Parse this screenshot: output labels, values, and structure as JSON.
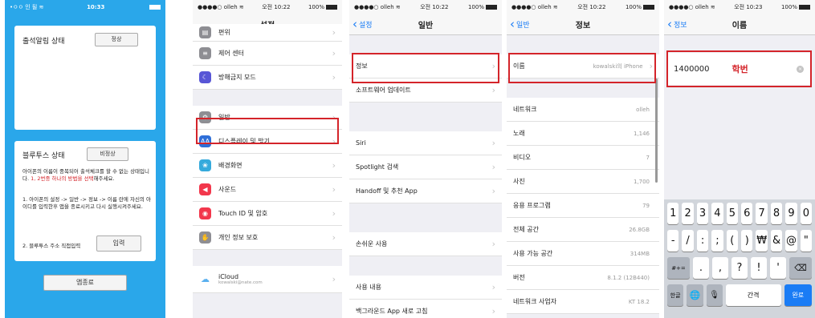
{
  "phone1": {
    "status": {
      "carrier": "•ㅇㅇ 인 될 ≋",
      "time": "10:33"
    },
    "attendance_label": "출석알림 상태",
    "attendance_value": "정상",
    "bt_label": "블루투스 상태",
    "bt_value": "비정상",
    "notice_a": "아이폰의 이름이 중복되어 출석체크를 할 수 없는 상태입니다.",
    "notice_red": "1, 2번중 하나의 방법을 선택",
    "notice_b": "해주세요.",
    "step1": "1. 아이폰의 설정 -> 일반 -> 정보 -> 이름 란에 자신의 아이디를 입력한후 앱을 종료시키고 다시 실행시켜주세요.",
    "step2": "2. 블루투스 주소 직접입력",
    "input_btn": "입력",
    "exit_btn": "앱종료"
  },
  "phone2": {
    "status": {
      "carrier": "●●●●○ olleh ≋",
      "time": "오전 10:22",
      "battery": "100%"
    },
    "title": "설정",
    "items": [
      {
        "label": "편위",
        "icon": "#8e8e93"
      },
      {
        "label": "제어 센터",
        "icon": "#8e8e93"
      },
      {
        "label": "방해금지 모드",
        "icon": "#5856d6"
      },
      {
        "label": "일반",
        "icon": "#8e8e93"
      },
      {
        "label": "디스플레이 및 밝기",
        "icon": "#2f6fd8"
      },
      {
        "label": "배경화면",
        "icon": "#35aadc"
      },
      {
        "label": "사운드",
        "icon": "#f2374c"
      },
      {
        "label": "Touch ID 및 암호",
        "icon": "#f2374c"
      },
      {
        "label": "개인 정보 보호",
        "icon": "#8e8e93"
      },
      {
        "label": "iCloud",
        "sub": "kowalski@nate.com",
        "icon": "#ffffff"
      }
    ]
  },
  "phone3": {
    "status": {
      "carrier": "●●●●○ olleh ≋",
      "time": "오전 10:22",
      "battery": "100%"
    },
    "back": "설정",
    "title": "일반",
    "items": [
      "정보",
      "소프트웨어 업데이트",
      "Siri",
      "Spotlight 검색",
      "Handoff 및 추천 App",
      "손쉬운 사용",
      "사용 내용",
      "백그라운드 App 새로 고침"
    ]
  },
  "phone4": {
    "status": {
      "carrier": "●●●●○ olleh ≋",
      "time": "오전 10:22",
      "battery": "100%"
    },
    "back": "일반",
    "title": "정보",
    "rows": [
      {
        "label": "이름",
        "value": "kowalski의 iPhone"
      },
      {
        "label": "네트워크",
        "value": "olleh"
      },
      {
        "label": "노래",
        "value": "1,146"
      },
      {
        "label": "비디오",
        "value": "7"
      },
      {
        "label": "사진",
        "value": "1,700"
      },
      {
        "label": "응용 프로그램",
        "value": "79"
      },
      {
        "label": "전체 공간",
        "value": "26.8GB"
      },
      {
        "label": "사용 가능 공간",
        "value": "314MB"
      },
      {
        "label": "버전",
        "value": "8.1.2 (12B440)"
      },
      {
        "label": "네트워크 사업자",
        "value": "KT 18.2"
      }
    ]
  },
  "phone5": {
    "status": {
      "carrier": "●●●●○ olleh ≋",
      "time": "오전 10:23",
      "battery": "100%"
    },
    "back": "정보",
    "title": "이름",
    "name_value": "1400000",
    "annotation": "학번",
    "keys_row1": [
      "1",
      "2",
      "3",
      "4",
      "5",
      "6",
      "7",
      "8",
      "9",
      "0"
    ],
    "keys_row2": [
      "-",
      "/",
      ":",
      ";",
      "(",
      ")",
      "₩",
      "&",
      "@",
      "\""
    ],
    "keys_row3": [
      "#+=",
      ".",
      ",",
      "?",
      "!",
      "'",
      "⌫"
    ],
    "keys_row4": [
      "한글",
      "🌐",
      "🎙",
      "간격",
      "완료"
    ]
  },
  "colors": {
    "app_blue": "#2aa7ea",
    "highlight_red": "#d4242a",
    "ios_blue": "#1a7cf5"
  }
}
